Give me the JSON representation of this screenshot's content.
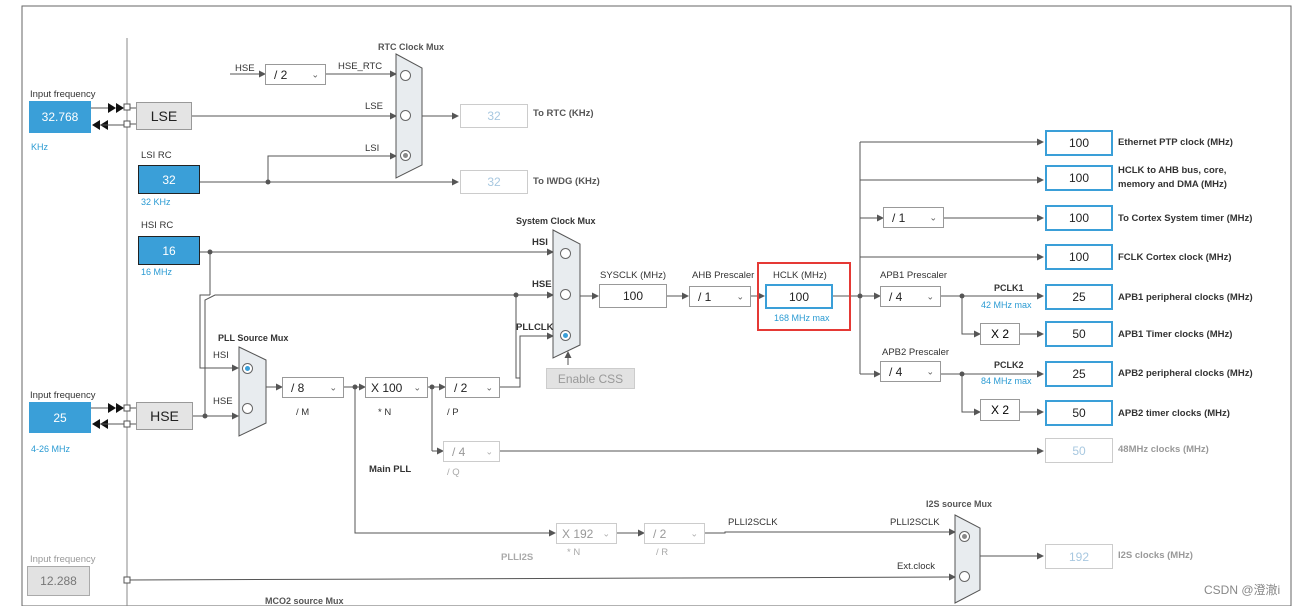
{
  "rtc_mux": {
    "title": "RTC Clock Mux",
    "hse_div": "/ 2",
    "hse_label": "HSE",
    "hse_rtc_label": "HSE_RTC",
    "lse_label": "LSE",
    "lsi_label": "LSI"
  },
  "to_rtc": {
    "value": "32",
    "label": "To RTC (KHz)"
  },
  "to_iwdg": {
    "value": "32",
    "label": "To IWDG (KHz)"
  },
  "lse_input": {
    "label": "Input frequency",
    "value": "32.768",
    "unit": "KHz",
    "osc": "LSE"
  },
  "lsi_rc": {
    "label": "LSI RC",
    "value": "32",
    "unit": "32 KHz"
  },
  "hsi_rc": {
    "label": "HSI RC",
    "value": "16",
    "unit": "16 MHz"
  },
  "hse_input": {
    "label": "Input frequency",
    "value": "25",
    "range": "4-26 MHz",
    "osc": "HSE"
  },
  "i2s_input": {
    "label": "Input frequency",
    "value": "12.288"
  },
  "pll_source_mux": {
    "title": "PLL Source Mux",
    "hsi": "HSI",
    "hse": "HSE"
  },
  "sys_clock_mux": {
    "title": "System Clock Mux",
    "hsi": "HSI",
    "hse": "HSE",
    "pll": "PLLCLK"
  },
  "main_pll": {
    "title": "Main PLL",
    "m": "/ 8",
    "m_label": "/ M",
    "n": "X 100",
    "n_label": "* N",
    "p": "/ 2",
    "p_label": "/ P",
    "q": "/ 4",
    "q_label": "/ Q"
  },
  "enable_css": "Enable CSS",
  "sysclk": {
    "label": "SYSCLK (MHz)",
    "value": "100"
  },
  "ahb": {
    "label": "AHB Prescaler",
    "value": "/ 1"
  },
  "hclk": {
    "label": "HCLK (MHz)",
    "value": "100",
    "max": "168 MHz max"
  },
  "apb1": {
    "label": "APB1 Prescaler",
    "value": "/ 4",
    "pclk": "PCLK1",
    "max": "42 MHz max",
    "timer_mult": "X 2"
  },
  "apb2": {
    "label": "APB2 Prescaler",
    "value": "/ 4",
    "pclk": "PCLK2",
    "max": "84 MHz max",
    "timer_mult": "X 2"
  },
  "cortex_div": "/ 1",
  "outputs": [
    {
      "value": "100",
      "label": "Ethernet PTP clock (MHz)"
    },
    {
      "value": "100",
      "label": "HCLK to AHB bus, core,",
      "label2": "memory and DMA (MHz)"
    },
    {
      "value": "100",
      "label": "To Cortex System timer (MHz)"
    },
    {
      "value": "100",
      "label": "FCLK Cortex clock (MHz)"
    },
    {
      "value": "25",
      "label": "APB1 peripheral clocks (MHz)"
    },
    {
      "value": "50",
      "label": "APB1 Timer clocks (MHz)"
    },
    {
      "value": "25",
      "label": "APB2 peripheral clocks (MHz)"
    },
    {
      "value": "50",
      "label": "APB2 timer clocks (MHz)"
    },
    {
      "value": "50",
      "label": "48MHz clocks (MHz)"
    }
  ],
  "plli2s": {
    "title": "PLLI2S",
    "n": "X 192",
    "n_label": "* N",
    "r": "/ 2",
    "r_label": "/ R",
    "clk": "PLLI2SCLK"
  },
  "i2s_mux": {
    "title": "I2S source Mux",
    "plli2sclk": "PLLI2SCLK",
    "ext": "Ext.clock"
  },
  "i2s_out": {
    "value": "192",
    "label": "I2S clocks (MHz)"
  },
  "mco2": "MCO2 source Mux",
  "watermark": "CSDN @澄澈i",
  "colors": {
    "accent": "#3a9fd8",
    "highlight": "#e53935",
    "pll_bg": "#d8e7f4"
  }
}
